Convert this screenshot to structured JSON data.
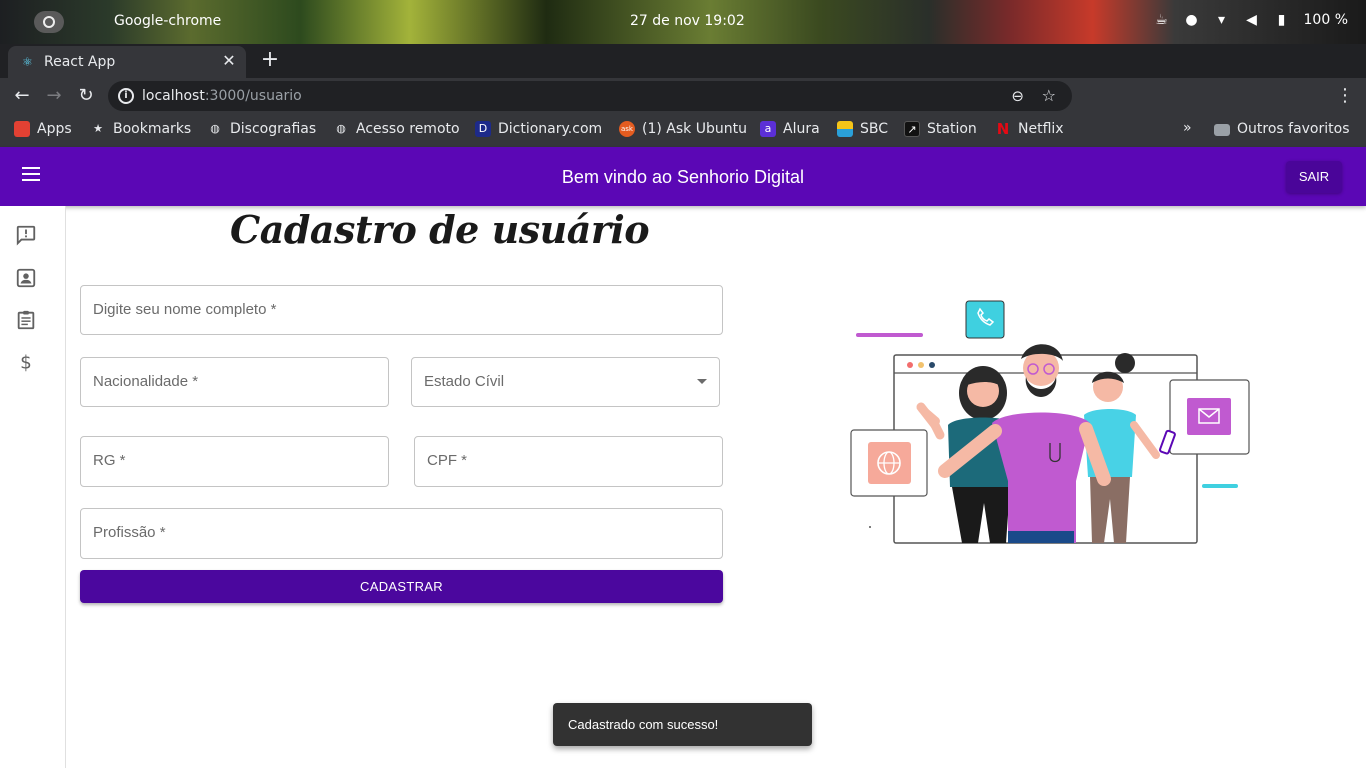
{
  "os": {
    "app_name": "Google-chrome",
    "clock": "27 de nov  19:02",
    "battery": "100 %"
  },
  "browser": {
    "tab_title": "React App",
    "url_host": "localhost",
    "url_rest": ":3000/usuario",
    "bookmarks": [
      {
        "label": "Apps",
        "icon": "apps-grid-icon",
        "color": "#e34133"
      },
      {
        "label": "Bookmarks",
        "icon": "star-icon",
        "color": "#e8eaed"
      },
      {
        "label": "Discografias",
        "icon": "globe-icon",
        "color": "#e8eaed"
      },
      {
        "label": "Acesso remoto",
        "icon": "globe-icon",
        "color": "#e8eaed"
      },
      {
        "label": "Dictionary.com",
        "icon": "dictionary-icon",
        "color": "#1d2a8a"
      },
      {
        "label": "(1) Ask Ubuntu",
        "icon": "askubuntu-icon",
        "color": "#e45c20"
      },
      {
        "label": "Alura",
        "icon": "alura-icon",
        "color": "#5b2fd6"
      },
      {
        "label": "SBC",
        "icon": "sbc-icon",
        "color": "#2aa0d8"
      },
      {
        "label": "Station",
        "icon": "station-icon",
        "color": "#111111"
      },
      {
        "label": "Netflix",
        "icon": "netflix-icon",
        "color": "#e50914"
      }
    ],
    "more": "»",
    "other_bookmarks": "Outros favoritos"
  },
  "appbar": {
    "title": "Bem vindo ao Senhorio Digital",
    "logout_label": "SAIR",
    "color": "#5b07b5"
  },
  "drawer": {
    "items": [
      {
        "icon": "feedback-icon"
      },
      {
        "icon": "contact-card-icon"
      },
      {
        "icon": "assignment-icon"
      },
      {
        "icon": "dollar-icon"
      }
    ]
  },
  "form": {
    "title": "Cadastro de usuário",
    "full_name_placeholder": "Digite seu nome completo *",
    "nationality_placeholder": "Nacionalidade *",
    "marital_status_placeholder": "Estado Cívil",
    "rg_placeholder": "RG *",
    "cpf_placeholder": "CPF *",
    "profession_placeholder": "Profissão *",
    "submit_label": "CADASTRAR",
    "submit_color": "#4b079e"
  },
  "snackbar": {
    "message": "Cadastrado com sucesso!"
  }
}
